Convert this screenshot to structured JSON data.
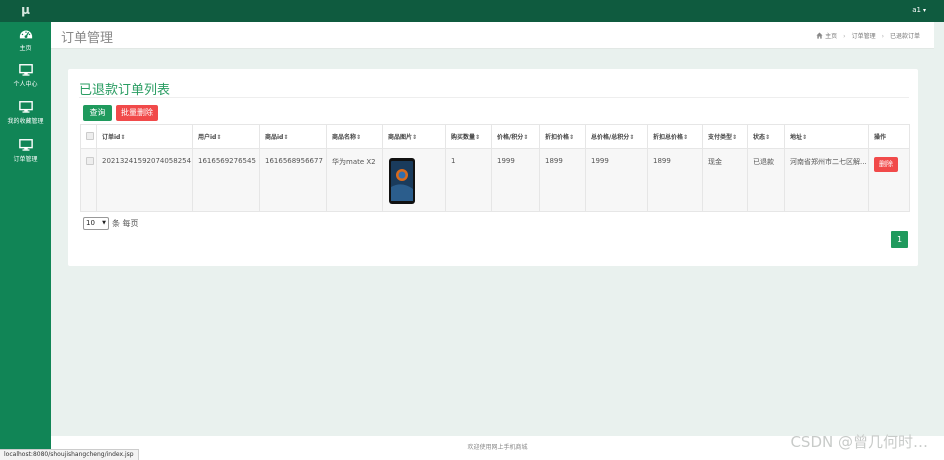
{
  "app": {
    "logo": "μ",
    "user": "a1"
  },
  "sidebar": {
    "items": [
      {
        "label": "主页",
        "icon": "dashboard-icon"
      },
      {
        "label": "个人中心",
        "icon": "monitor-icon"
      },
      {
        "label": "我的收藏管理",
        "icon": "monitor-icon"
      },
      {
        "label": "订单管理",
        "icon": "monitor-icon"
      }
    ]
  },
  "header": {
    "title": "订单管理",
    "breadcrumb": [
      "主页",
      "订单管理",
      "已退款订单"
    ]
  },
  "card": {
    "title": "已退款订单列表",
    "search_label": "查询",
    "batch_delete_label": "批量删除"
  },
  "table": {
    "columns": [
      "订单id",
      "用户id",
      "商品id",
      "商品名称",
      "商品图片",
      "购买数量",
      "价格/积分",
      "折扣价格",
      "总价格/总积分",
      "折扣总价格",
      "支付类型",
      "状态",
      "地址",
      "操作"
    ],
    "rows": [
      {
        "order_id": "20213241592074058254",
        "user_id": "1616569276545",
        "product_id": "1616568956677",
        "product_name": "华为mate X2",
        "quantity": "1",
        "price": "1999",
        "discount_price": "1899",
        "total": "1999",
        "discount_total": "1899",
        "pay_type": "现金",
        "status": "已退款",
        "address": "河南省郑州市二七区解...",
        "action": "删除"
      }
    ]
  },
  "pager": {
    "page_size": "10",
    "page_size_suffix": "条 每页",
    "current_page": "1"
  },
  "footer": {
    "text": "欢迎使用网上手机商城"
  },
  "statusbar": {
    "url": "localhost:8080/shoujishangcheng/index.jsp"
  },
  "watermark": {
    "text": "CSDN @曾几何时…"
  },
  "colors": {
    "topbar": "#0f5b3f",
    "sidebar": "#118556",
    "accent_green": "#1f9a5d",
    "danger_red": "#f14a4a",
    "background": "#e9f1ee"
  }
}
